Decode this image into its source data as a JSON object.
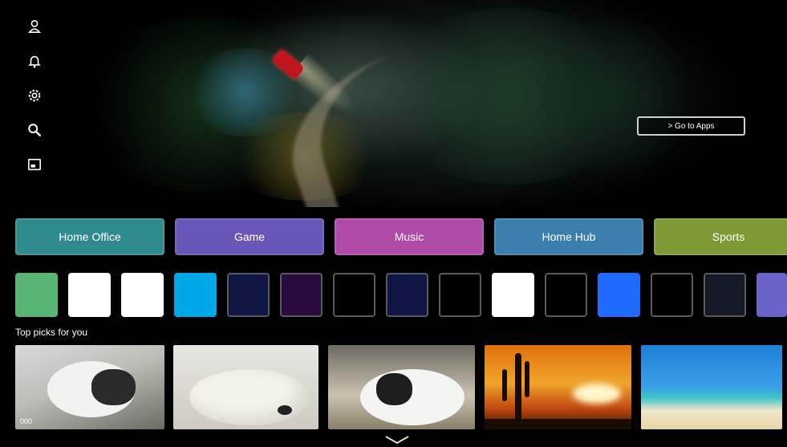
{
  "hero": {
    "go_to_apps": "> Go to Apps"
  },
  "sidenav": [
    {
      "icon": "profile-icon"
    },
    {
      "icon": "notification-bell-icon"
    },
    {
      "icon": "settings-gear-icon"
    },
    {
      "icon": "search-icon"
    },
    {
      "icon": "input-source-icon"
    }
  ],
  "categories": [
    {
      "label": "Home Office",
      "color": "#2f8a8e"
    },
    {
      "label": "Game",
      "color": "#6a56b8"
    },
    {
      "label": "Music",
      "color": "#b04aa8"
    },
    {
      "label": "Home Hub",
      "color": "#3a7fae"
    },
    {
      "label": "Sports",
      "color": "#7e9a34"
    }
  ],
  "apps": [
    {
      "color": "#58b573"
    },
    {
      "color": "#ffffff"
    },
    {
      "color": "#ffffff"
    },
    {
      "color": "#00a7e6"
    },
    {
      "color": "#0f1646"
    },
    {
      "color": "#2a0b3e"
    },
    {
      "color": "#000000"
    },
    {
      "color": "#0f1646"
    },
    {
      "color": "#000000"
    },
    {
      "color": "#ffffff"
    },
    {
      "color": "#000000"
    },
    {
      "color": "#1f6bff"
    },
    {
      "color": "#000000"
    },
    {
      "color": "#121826"
    },
    {
      "color": "#6a63c9"
    }
  ],
  "top_picks": {
    "title": "Top picks for you",
    "items": [
      {
        "subject": "sleeping-cat",
        "label": "000"
      },
      {
        "subject": "sleeping-dog",
        "label": ""
      },
      {
        "subject": "lying-cat",
        "label": ""
      },
      {
        "subject": "cactus-sunset",
        "label": ""
      },
      {
        "subject": "beach",
        "label": ""
      }
    ]
  }
}
